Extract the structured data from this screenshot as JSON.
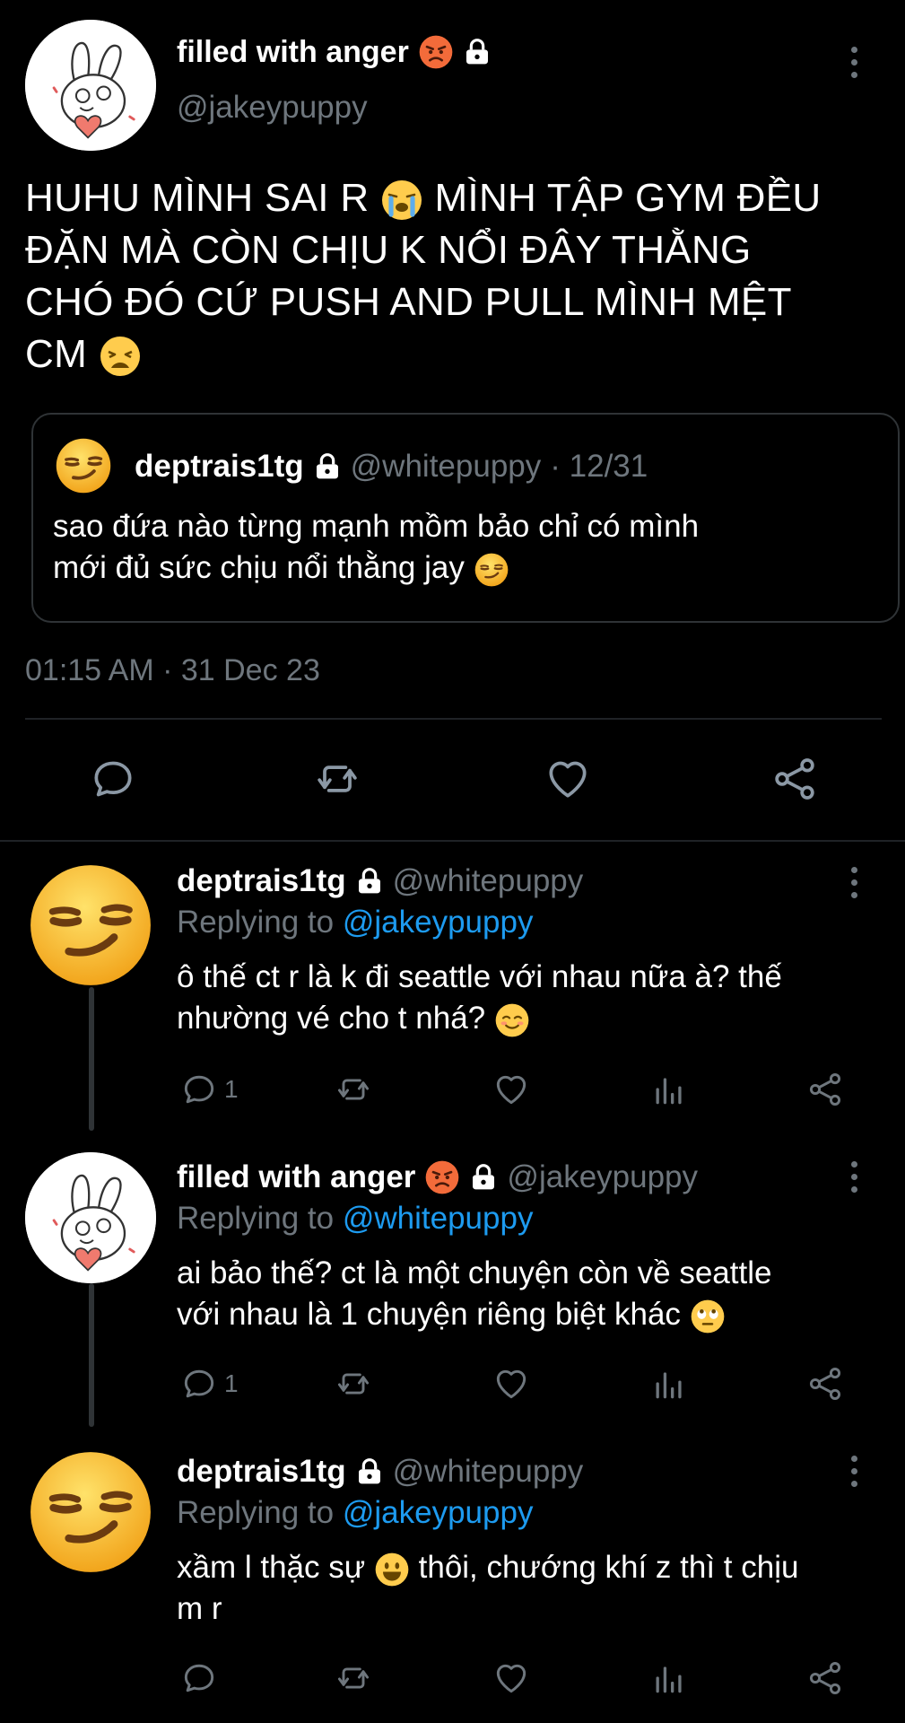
{
  "main_tweet": {
    "display_name": "filled with anger",
    "handle": "@jakeypuppy",
    "text_line1": "HUHU MÌNH SAI R",
    "text_line1b": "MÌNH TẬP GYM ĐỀU",
    "text_line2": "ĐẶN MÀ CÒN CHỊU K NỔI ĐÂY THẰNG",
    "text_line3": "CHÓ ĐÓ CỨ PUSH AND PULL MÌNH MỆT",
    "text_line4": "CM",
    "timestamp": "01:15 AM · 31 Dec 23",
    "quote": {
      "display_name": "deptrais1tg",
      "handle": "@whitepuppy",
      "date": "· 12/31",
      "text_line1": "sao đứa nào từng mạnh mồm bảo chỉ có mình",
      "text_line2": "mới đủ sức chịu nổi thằng jay"
    }
  },
  "replies": [
    {
      "display_name": "deptrais1tg",
      "handle": "@whitepuppy",
      "replying_label": "Replying to",
      "replying_to": "@jakeypuppy",
      "text_line1": "ô thế ct r là k đi seattle với nhau nữa à? thế",
      "text_line2": "nhường vé cho t nhá?",
      "reply_count": "1"
    },
    {
      "display_name": "filled with anger",
      "handle": "@jakeypuppy",
      "replying_label": "Replying to",
      "replying_to": "@whitepuppy",
      "text_line1": "ai bảo thế? ct là một chuyện còn về seattle",
      "text_line2": "với nhau là 1 chuyện riêng biệt khác",
      "reply_count": "1"
    },
    {
      "display_name": "deptrais1tg",
      "handle": "@whitepuppy",
      "replying_label": "Replying to",
      "replying_to": "@jakeypuppy",
      "text_line1a": "xầm l thặc sự",
      "text_line1b": "thôi, chướng khí z thì t chịu",
      "text_line2": "m r",
      "reply_count": ""
    }
  ],
  "icons": {
    "reply": "reply-icon",
    "retweet": "retweet-icon",
    "like": "heart-icon",
    "share": "share-icon",
    "analytics": "analytics-icon",
    "lock": "lock-icon",
    "more": "more-vertical-icon"
  },
  "colors": {
    "background": "#000000",
    "text": "#ffffff",
    "muted": "#6e767d",
    "link": "#1d9bf0"
  }
}
